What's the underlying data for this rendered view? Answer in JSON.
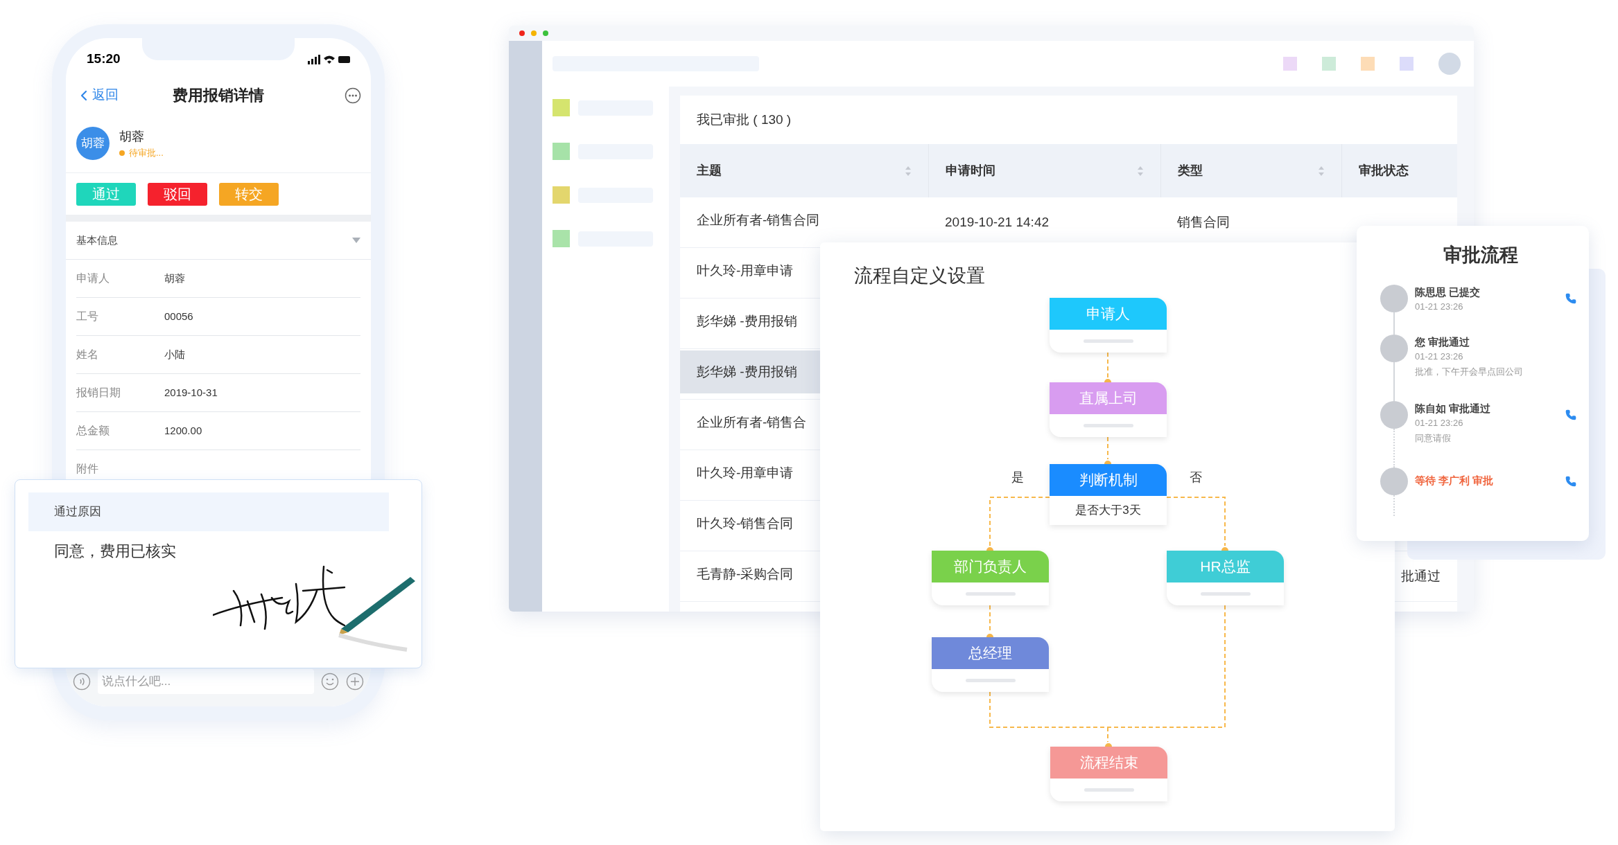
{
  "phone": {
    "time": "15:20",
    "back": "返回",
    "title": "费用报销详情",
    "applicant": {
      "avatar": "胡蓉",
      "name": "胡蓉",
      "status": "待审批..."
    },
    "actions": [
      {
        "label": "通过",
        "color": "#1fd6bb"
      },
      {
        "label": "驳回",
        "color": "#f5222d"
      },
      {
        "label": "转交",
        "color": "#f5a623"
      }
    ],
    "section": {
      "title": "基本信息",
      "expanded": true
    },
    "fields": [
      {
        "label": "申请人",
        "value": "胡蓉"
      },
      {
        "label": "工号",
        "value": "00056"
      },
      {
        "label": "姓名",
        "value": "小陆"
      },
      {
        "label": "报销日期",
        "value": "2019-10-31"
      },
      {
        "label": "总金额",
        "value": "1200.00"
      },
      {
        "label": "附件"
      }
    ],
    "reason_card": {
      "heading": "通过原因",
      "text": "同意，费用已核实"
    },
    "chat": {
      "placeholder": "说点什么吧..."
    }
  },
  "desktop": {
    "toolbar_swatches": [
      {
        "color": "#ecd9f7"
      },
      {
        "color": "#cdebd9"
      },
      {
        "color": "#fddcb6"
      },
      {
        "color": "#dcdcfa"
      }
    ],
    "sidebar": [
      {
        "color": "#d5e46e"
      },
      {
        "color": "#a6e2a8"
      },
      {
        "color": "#e3d66d"
      },
      {
        "color": "#a9e3a9"
      }
    ],
    "table": {
      "title": "我已审批 ( 130 )",
      "columns": [
        {
          "label": "主题",
          "sortable": true
        },
        {
          "label": "申请时间",
          "sortable": true
        },
        {
          "label": "类型",
          "sortable": true
        },
        {
          "label": "审批状态",
          "sortable": false
        }
      ],
      "rows": [
        {
          "subject": "企业所有者-销售合同",
          "time": "2019-10-21 14:42",
          "type": "销售合同",
          "selected": false
        },
        {
          "subject": "叶久玲-用章申请",
          "selected": false
        },
        {
          "subject": "彭华娣 -费用报销",
          "selected": false
        },
        {
          "subject": "彭华娣 -费用报销",
          "selected": true
        },
        {
          "subject": "企业所有者-销售合",
          "selected": false
        },
        {
          "subject": "叶久玲-用章申请",
          "selected": false
        },
        {
          "subject": "叶久玲-销售合同",
          "selected": false
        },
        {
          "subject": "毛青静-采购合同",
          "status": "批通过",
          "selected": false
        }
      ]
    }
  },
  "flow": {
    "title": "流程自定义设置",
    "branch_labels": [
      "是",
      "否"
    ],
    "nodes": [
      {
        "label": "申请人",
        "color": "#1ec8fc"
      },
      {
        "label": "直属上司",
        "color": "#d89cf0"
      },
      {
        "label": "判断机制",
        "color": "#1a8cff",
        "note": "是否大于3天"
      },
      {
        "label": "部门负责人",
        "color": "#7ad14b"
      },
      {
        "label": "HR总监",
        "color": "#3fcdd6"
      },
      {
        "label": "总经理",
        "color": "#6f89da"
      },
      {
        "label": "流程结束",
        "color": "#f59896"
      }
    ]
  },
  "approval": {
    "title": "审批流程",
    "steps": [
      {
        "actor": "陈思思 已提交",
        "time": "01-21 23:26",
        "pending": false,
        "phone": true
      },
      {
        "actor": "您 审批通过",
        "time": "01-21 23:26",
        "comment": "批准，下午开会早点回公司",
        "pending": false,
        "phone": false
      },
      {
        "actor": "陈自如 审批通过",
        "time": "01-21 23:26",
        "comment": "同意请假",
        "pending": false,
        "phone": true
      },
      {
        "actor": "等待 李广利 审批",
        "pending": true,
        "phone": true
      }
    ]
  }
}
